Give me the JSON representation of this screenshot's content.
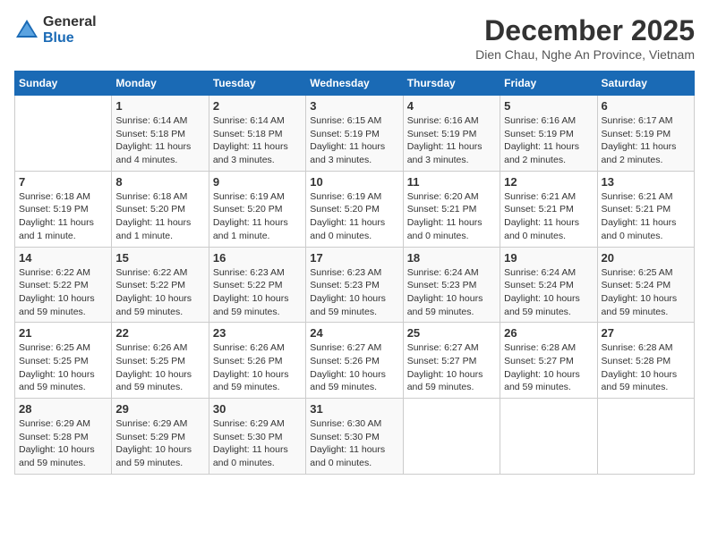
{
  "header": {
    "logo_general": "General",
    "logo_blue": "Blue",
    "month_title": "December 2025",
    "location": "Dien Chau, Nghe An Province, Vietnam"
  },
  "weekdays": [
    "Sunday",
    "Monday",
    "Tuesday",
    "Wednesday",
    "Thursday",
    "Friday",
    "Saturday"
  ],
  "weeks": [
    [
      {
        "day": "",
        "info": ""
      },
      {
        "day": "1",
        "info": "Sunrise: 6:14 AM\nSunset: 5:18 PM\nDaylight: 11 hours\nand 4 minutes."
      },
      {
        "day": "2",
        "info": "Sunrise: 6:14 AM\nSunset: 5:18 PM\nDaylight: 11 hours\nand 3 minutes."
      },
      {
        "day": "3",
        "info": "Sunrise: 6:15 AM\nSunset: 5:19 PM\nDaylight: 11 hours\nand 3 minutes."
      },
      {
        "day": "4",
        "info": "Sunrise: 6:16 AM\nSunset: 5:19 PM\nDaylight: 11 hours\nand 3 minutes."
      },
      {
        "day": "5",
        "info": "Sunrise: 6:16 AM\nSunset: 5:19 PM\nDaylight: 11 hours\nand 2 minutes."
      },
      {
        "day": "6",
        "info": "Sunrise: 6:17 AM\nSunset: 5:19 PM\nDaylight: 11 hours\nand 2 minutes."
      }
    ],
    [
      {
        "day": "7",
        "info": "Sunrise: 6:18 AM\nSunset: 5:19 PM\nDaylight: 11 hours\nand 1 minute."
      },
      {
        "day": "8",
        "info": "Sunrise: 6:18 AM\nSunset: 5:20 PM\nDaylight: 11 hours\nand 1 minute."
      },
      {
        "day": "9",
        "info": "Sunrise: 6:19 AM\nSunset: 5:20 PM\nDaylight: 11 hours\nand 1 minute."
      },
      {
        "day": "10",
        "info": "Sunrise: 6:19 AM\nSunset: 5:20 PM\nDaylight: 11 hours\nand 0 minutes."
      },
      {
        "day": "11",
        "info": "Sunrise: 6:20 AM\nSunset: 5:21 PM\nDaylight: 11 hours\nand 0 minutes."
      },
      {
        "day": "12",
        "info": "Sunrise: 6:21 AM\nSunset: 5:21 PM\nDaylight: 11 hours\nand 0 minutes."
      },
      {
        "day": "13",
        "info": "Sunrise: 6:21 AM\nSunset: 5:21 PM\nDaylight: 11 hours\nand 0 minutes."
      }
    ],
    [
      {
        "day": "14",
        "info": "Sunrise: 6:22 AM\nSunset: 5:22 PM\nDaylight: 10 hours\nand 59 minutes."
      },
      {
        "day": "15",
        "info": "Sunrise: 6:22 AM\nSunset: 5:22 PM\nDaylight: 10 hours\nand 59 minutes."
      },
      {
        "day": "16",
        "info": "Sunrise: 6:23 AM\nSunset: 5:22 PM\nDaylight: 10 hours\nand 59 minutes."
      },
      {
        "day": "17",
        "info": "Sunrise: 6:23 AM\nSunset: 5:23 PM\nDaylight: 10 hours\nand 59 minutes."
      },
      {
        "day": "18",
        "info": "Sunrise: 6:24 AM\nSunset: 5:23 PM\nDaylight: 10 hours\nand 59 minutes."
      },
      {
        "day": "19",
        "info": "Sunrise: 6:24 AM\nSunset: 5:24 PM\nDaylight: 10 hours\nand 59 minutes."
      },
      {
        "day": "20",
        "info": "Sunrise: 6:25 AM\nSunset: 5:24 PM\nDaylight: 10 hours\nand 59 minutes."
      }
    ],
    [
      {
        "day": "21",
        "info": "Sunrise: 6:25 AM\nSunset: 5:25 PM\nDaylight: 10 hours\nand 59 minutes."
      },
      {
        "day": "22",
        "info": "Sunrise: 6:26 AM\nSunset: 5:25 PM\nDaylight: 10 hours\nand 59 minutes."
      },
      {
        "day": "23",
        "info": "Sunrise: 6:26 AM\nSunset: 5:26 PM\nDaylight: 10 hours\nand 59 minutes."
      },
      {
        "day": "24",
        "info": "Sunrise: 6:27 AM\nSunset: 5:26 PM\nDaylight: 10 hours\nand 59 minutes."
      },
      {
        "day": "25",
        "info": "Sunrise: 6:27 AM\nSunset: 5:27 PM\nDaylight: 10 hours\nand 59 minutes."
      },
      {
        "day": "26",
        "info": "Sunrise: 6:28 AM\nSunset: 5:27 PM\nDaylight: 10 hours\nand 59 minutes."
      },
      {
        "day": "27",
        "info": "Sunrise: 6:28 AM\nSunset: 5:28 PM\nDaylight: 10 hours\nand 59 minutes."
      }
    ],
    [
      {
        "day": "28",
        "info": "Sunrise: 6:29 AM\nSunset: 5:28 PM\nDaylight: 10 hours\nand 59 minutes."
      },
      {
        "day": "29",
        "info": "Sunrise: 6:29 AM\nSunset: 5:29 PM\nDaylight: 10 hours\nand 59 minutes."
      },
      {
        "day": "30",
        "info": "Sunrise: 6:29 AM\nSunset: 5:30 PM\nDaylight: 11 hours\nand 0 minutes."
      },
      {
        "day": "31",
        "info": "Sunrise: 6:30 AM\nSunset: 5:30 PM\nDaylight: 11 hours\nand 0 minutes."
      },
      {
        "day": "",
        "info": ""
      },
      {
        "day": "",
        "info": ""
      },
      {
        "day": "",
        "info": ""
      }
    ]
  ]
}
